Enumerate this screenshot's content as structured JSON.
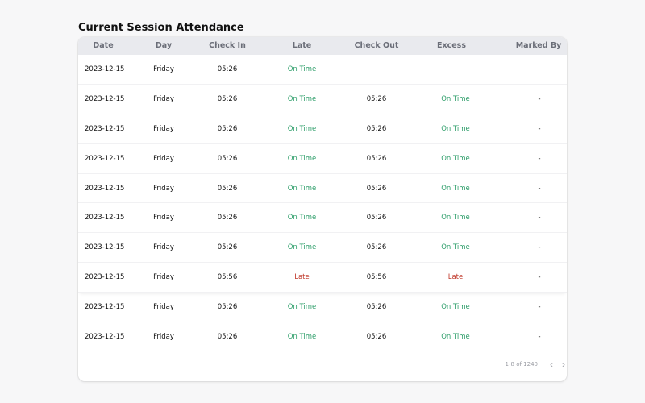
{
  "page": {
    "title": "Current Session Attendance"
  },
  "colors": {
    "on_time": "#2e9e6a",
    "late": "#c0392b",
    "header_bg": "#e9eaee"
  },
  "table": {
    "headers": [
      "Date",
      "Day",
      "Check In",
      "Late",
      "Check Out",
      "Excess",
      "Marked By"
    ],
    "rows": [
      {
        "date": "2023-12-15",
        "day": "Friday",
        "check_in": "05:26",
        "late": "On Time",
        "late_status": "on_time",
        "check_out": "",
        "excess": "",
        "excess_status": "",
        "marked_by": ""
      },
      {
        "date": "2023-12-15",
        "day": "Friday",
        "check_in": "05:26",
        "late": "On Time",
        "late_status": "on_time",
        "check_out": "05:26",
        "excess": "On Time",
        "excess_status": "on_time",
        "marked_by": "-"
      },
      {
        "date": "2023-12-15",
        "day": "Friday",
        "check_in": "05:26",
        "late": "On Time",
        "late_status": "on_time",
        "check_out": "05:26",
        "excess": "On Time",
        "excess_status": "on_time",
        "marked_by": "-"
      },
      {
        "date": "2023-12-15",
        "day": "Friday",
        "check_in": "05:26",
        "late": "On Time",
        "late_status": "on_time",
        "check_out": "05:26",
        "excess": "On Time",
        "excess_status": "on_time",
        "marked_by": "-"
      },
      {
        "date": "2023-12-15",
        "day": "Friday",
        "check_in": "05:26",
        "late": "On Time",
        "late_status": "on_time",
        "check_out": "05:26",
        "excess": "On Time",
        "excess_status": "on_time",
        "marked_by": "-"
      },
      {
        "date": "2023-12-15",
        "day": "Friday",
        "check_in": "05:26",
        "late": "On Time",
        "late_status": "on_time",
        "check_out": "05:26",
        "excess": "On Time",
        "excess_status": "on_time",
        "marked_by": "-"
      },
      {
        "date": "2023-12-15",
        "day": "Friday",
        "check_in": "05:26",
        "late": "On Time",
        "late_status": "on_time",
        "check_out": "05:26",
        "excess": "On Time",
        "excess_status": "on_time",
        "marked_by": "-"
      },
      {
        "date": "2023-12-15",
        "day": "Friday",
        "check_in": "05:56",
        "late": "Late",
        "late_status": "late",
        "check_out": "05:56",
        "excess": "Late",
        "excess_status": "late",
        "marked_by": "-"
      },
      {
        "date": "2023-12-15",
        "day": "Friday",
        "check_in": "05:26",
        "late": "On Time",
        "late_status": "on_time",
        "check_out": "05:26",
        "excess": "On Time",
        "excess_status": "on_time",
        "marked_by": "-"
      },
      {
        "date": "2023-12-15",
        "day": "Friday",
        "check_in": "05:26",
        "late": "On Time",
        "late_status": "on_time",
        "check_out": "05:26",
        "excess": "On Time",
        "excess_status": "on_time",
        "marked_by": "-"
      }
    ]
  },
  "pagination": {
    "range_text": "1-8 of 1240",
    "prev_icon": "chevron-left-icon",
    "next_icon": "chevron-right-icon"
  }
}
